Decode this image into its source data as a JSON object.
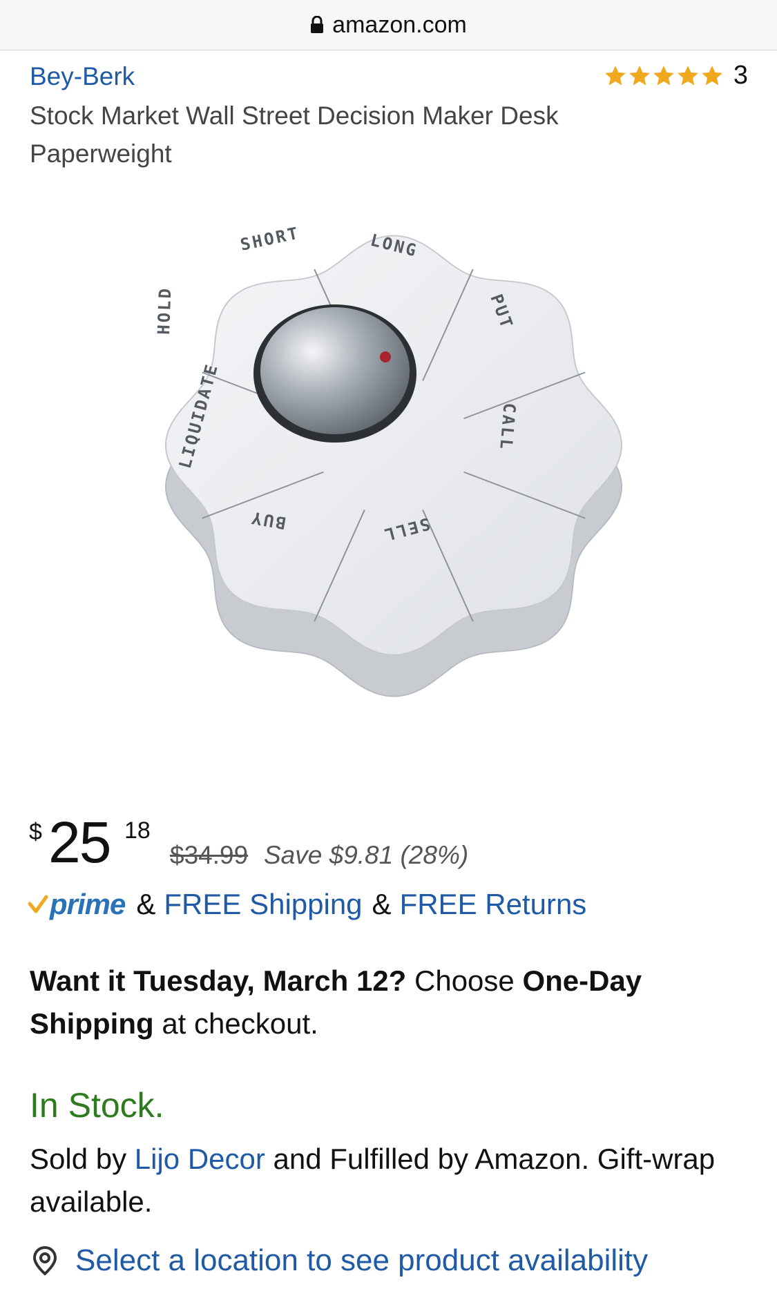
{
  "browser": {
    "url": "amazon.com",
    "lock_icon": "lock-icon"
  },
  "product": {
    "brand": "Bey-Berk",
    "title": "Stock Market Wall Street Decision Maker Desk Paperweight",
    "rating": {
      "stars": 5,
      "max": 5,
      "count": "3",
      "star_color": "#f0a81f"
    },
    "image": {
      "labels": [
        "SHORT",
        "LONG",
        "PUT",
        "CALL",
        "SELL",
        "BUY",
        "LIQUIDATE",
        "HOLD"
      ]
    }
  },
  "price": {
    "currency": "$",
    "whole": "25",
    "fraction": "18",
    "list_price": "$34.99",
    "savings": "Save $9.81 (28%)"
  },
  "shipping": {
    "prime_label": "prime",
    "amp1": "&",
    "free_shipping": "FREE Shipping",
    "amp2": "&",
    "free_returns": "FREE Returns"
  },
  "delivery": {
    "date_bold": "Want it Tuesday, March 12?",
    "choose": "Choose",
    "option_bold": "One-Day Shipping",
    "suffix": "at checkout."
  },
  "stock": {
    "status": "In Stock.",
    "status_color": "#2e7a1f",
    "sold_by_prefix": "Sold by",
    "seller": "Lijo Decor",
    "sold_by_suffix": "and Fulfilled by Amazon. Gift-wrap available."
  },
  "location": {
    "icon": "location-pin-icon",
    "link": "Select a location to see product availability"
  },
  "colors": {
    "link": "#1f5aa6",
    "prime_blue": "#2a72b8",
    "prime_check": "#f0a81f"
  }
}
